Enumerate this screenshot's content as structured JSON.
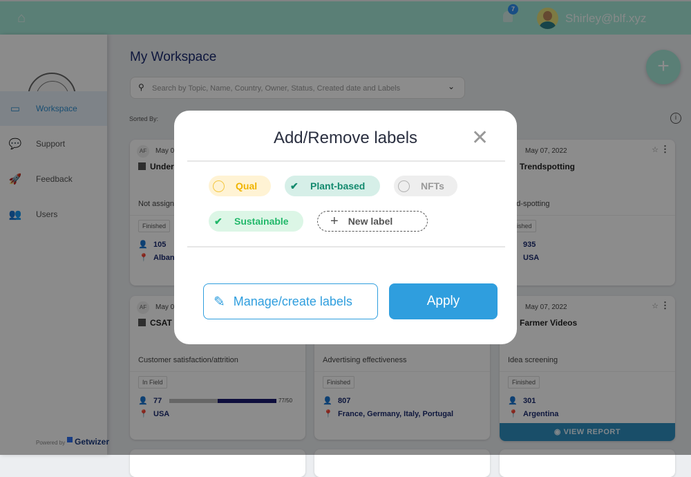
{
  "header": {
    "notification_count": "7",
    "user_email": "Shirley@blf.xyz"
  },
  "sidebar": {
    "items": [
      {
        "label": "Workspace",
        "icon": "monitor-icon",
        "active": true
      },
      {
        "label": "Support",
        "icon": "chat-icon"
      },
      {
        "label": "Feedback",
        "icon": "rocket-icon"
      },
      {
        "label": "Users",
        "icon": "users-icon"
      }
    ],
    "powered_by": "Powered by",
    "brand": "Getwizer"
  },
  "main": {
    "title": "My Workspace",
    "search_placeholder": "Search by Topic, Name, Country, Owner, Status, Created date and Labels",
    "sorted_by": "Sorted By:"
  },
  "cards": [
    {
      "initials": "AF",
      "date": "May 0",
      "title": "Under",
      "subtitle": "Not assign",
      "status": "Finished",
      "count": "105",
      "location": "Alban"
    },
    {
      "date": "May 07, 2022",
      "title": "Trendspotting",
      "subtitle": "end-spotting",
      "status": "inished",
      "count": "935",
      "location": "USA"
    },
    {
      "initials": "AF",
      "date": "May 0",
      "title": "CSAT I",
      "subtitle": "Customer satisfaction/attrition",
      "status": "In Field",
      "count": "77",
      "progress": "77/50",
      "progress_fraction": 0.55,
      "location": "USA"
    },
    {
      "subtitle": "Advertising effectiveness",
      "status": "Finished",
      "count": "807",
      "location": "France, Germany, Italy, Portugal"
    },
    {
      "date": "May 07, 2022",
      "title": "Farmer Videos",
      "subtitle": "Idea screening",
      "status": "Finished",
      "count": "301",
      "location": "Argentina",
      "action": "VIEW REPORT"
    }
  ],
  "modal": {
    "title": "Add/Remove labels",
    "labels": [
      {
        "name": "Qual",
        "selected": false,
        "color": "#f0b400",
        "bg": "#fff3d4"
      },
      {
        "name": "Plant-based",
        "selected": true,
        "color": "#138a6e",
        "bg": "#d6efe8"
      },
      {
        "name": "NFTs",
        "selected": false,
        "color": "#999999",
        "bg": "#eeeeee"
      },
      {
        "name": "Sustainable",
        "selected": true,
        "color": "#22b86a",
        "bg": "#dcf6e6"
      }
    ],
    "new_label": "New label",
    "manage_button": "Manage/create labels",
    "apply_button": "Apply"
  }
}
